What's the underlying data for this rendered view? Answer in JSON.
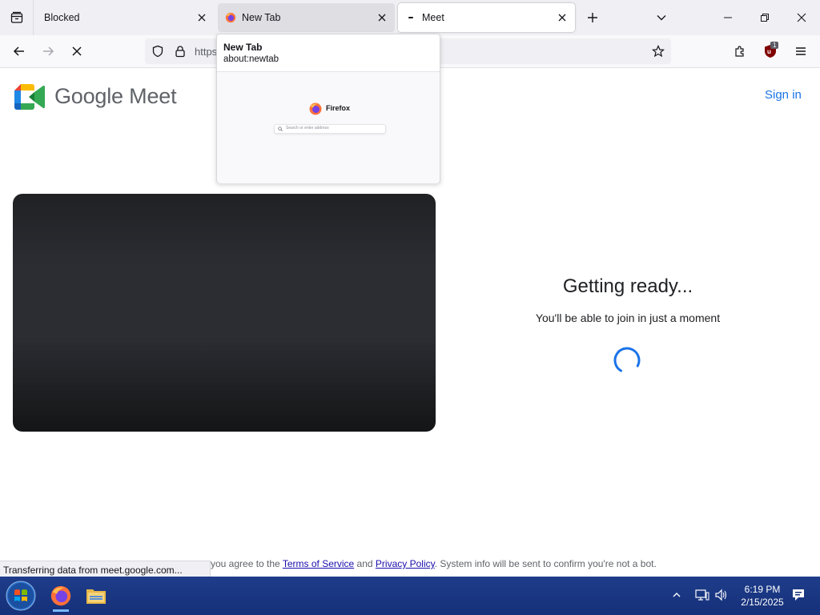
{
  "browser": {
    "tabs": [
      {
        "label": "Blocked"
      },
      {
        "label": "New Tab"
      },
      {
        "label": "Meet"
      }
    ],
    "url_partial": "https:",
    "extension_badge": "1",
    "status_text": "Transferring data from meet.google.com..."
  },
  "tab_preview": {
    "title": "New Tab",
    "url": "about:newtab",
    "brand": "Firefox",
    "search_placeholder": "Search or enter address"
  },
  "page": {
    "brand": "Google Meet",
    "sign_in": "Sign in",
    "ready_title": "Getting ready...",
    "ready_subtitle": "You'll be able to join in just a moment",
    "footer": {
      "prefix": "you agree to the ",
      "terms": "Terms of Service",
      "and": " and ",
      "privacy": "Privacy Policy",
      "suffix": ". System info will be sent to confirm you're not a bot."
    }
  },
  "taskbar": {
    "time": "6:19 PM",
    "date": "2/15/2025"
  },
  "colors": {
    "accent": "#1a73e8",
    "taskbar": "#16307a",
    "video_bg": "#2b2d33"
  }
}
